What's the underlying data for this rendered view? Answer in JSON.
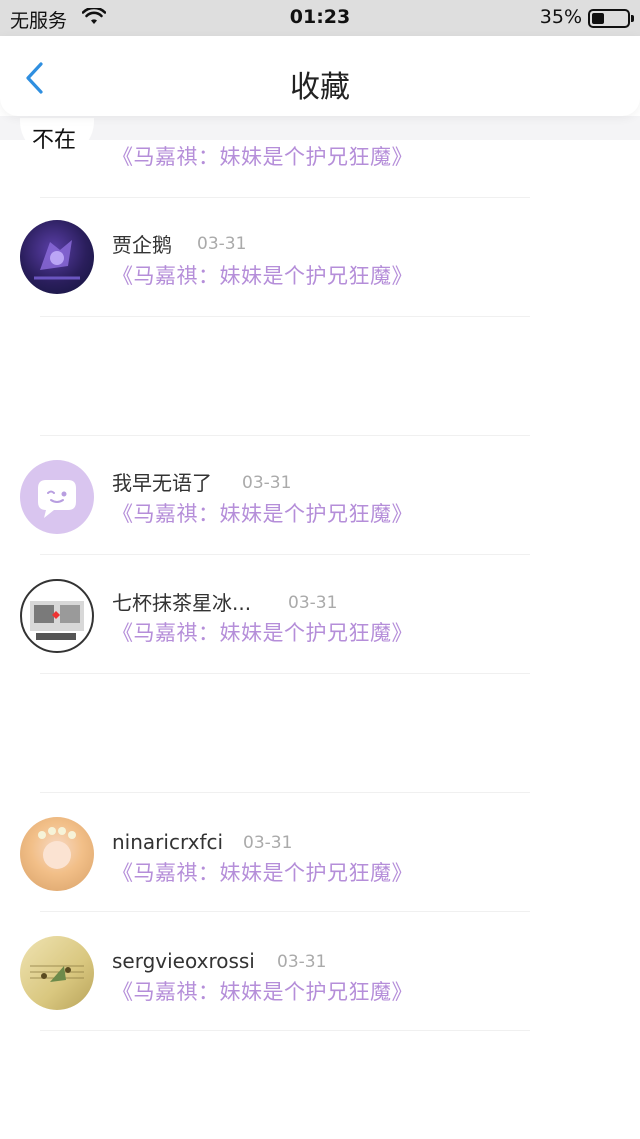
{
  "status_bar": {
    "carrier": "无服务",
    "time": "01:23",
    "battery_percent": "35%",
    "battery_level": 0.35
  },
  "header": {
    "title": "收藏",
    "back_icon": "chevron-left-icon"
  },
  "items": [
    {
      "name": "不在",
      "date": "",
      "quote": "《马嘉祺：妹妹是个护兄狂魔》"
    },
    {
      "name": "贾企鹅",
      "date": "03-31",
      "quote": "《马嘉祺：妹妹是个护兄狂魔》"
    },
    {
      "name": "我早无语了",
      "date": "03-31",
      "quote": "《马嘉祺：妹妹是个护兄狂魔》"
    },
    {
      "name": "七杯抹茶星冰...",
      "date": "03-31",
      "quote": "《马嘉祺：妹妹是个护兄狂魔》"
    },
    {
      "name": "ninaricrxfci",
      "date": "03-31",
      "quote": "《马嘉祺：妹妹是个护兄狂魔》"
    },
    {
      "name": "sergvieoxrossi",
      "date": "03-31",
      "quote": "《马嘉祺：妹妹是个护兄狂魔》"
    }
  ],
  "colors": {
    "accent_blue": "#2f8fe0",
    "quote_purple": "#b58ed9",
    "chat_avatar_bg": "#d9c5ef"
  }
}
